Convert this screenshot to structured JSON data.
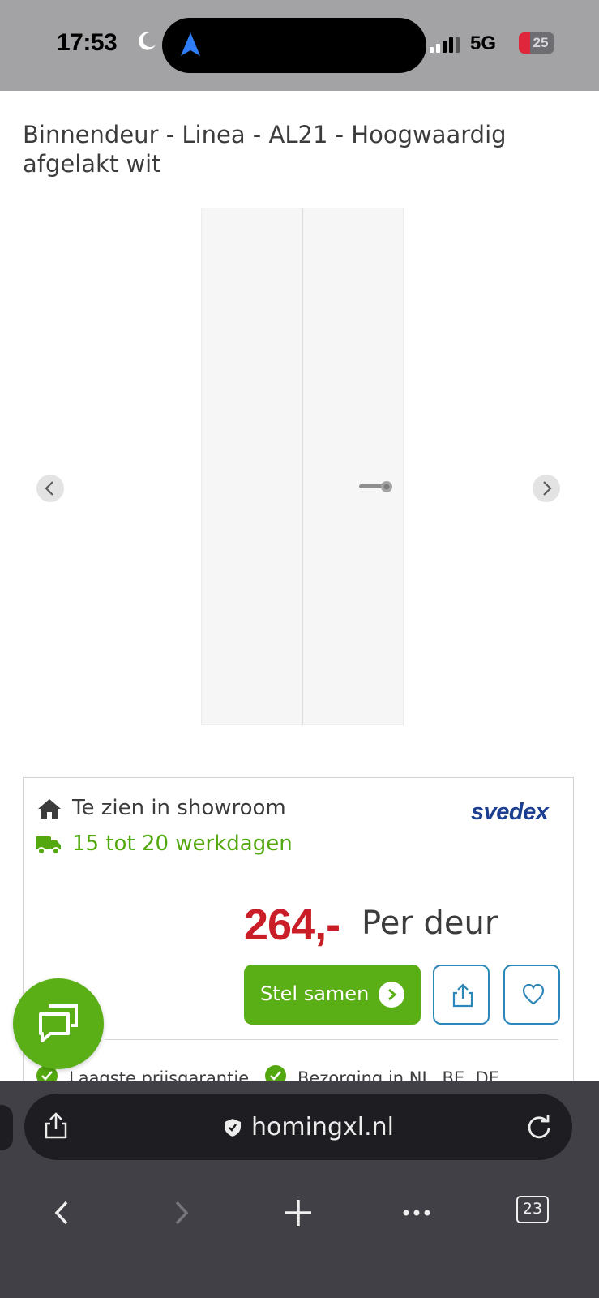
{
  "status_bar": {
    "time": "17:53",
    "network": "5G",
    "battery": "25"
  },
  "product": {
    "title": "Binnendeur - Linea - AL21 - Hoogwaardig afgelakt wit",
    "showroom": "Te zien in showroom",
    "delivery": "15 tot 20 werkdagen",
    "brand": "svedex",
    "price": "264,-",
    "price_unit": "Per deur",
    "cta_label": "Stel samen",
    "usps": [
      "Laagste prijsgarantie",
      "Bezorging in NL, BE, DE"
    ]
  },
  "browser": {
    "url": "homingxl.nl",
    "tab_count": "23"
  },
  "colors": {
    "accent_green": "#5aae16",
    "delivery_green": "#53a80f",
    "price_red": "#c91e27",
    "brand_blue": "#1c3f8f",
    "outline_blue": "#2d86b8",
    "browser_bar": "#404046"
  },
  "icons": {
    "status_moon": "moon-icon",
    "island_location": "location-arrow-icon",
    "gallery_prev": "chevron-left-icon",
    "gallery_next": "chevron-right-icon",
    "showroom": "home-icon",
    "delivery": "truck-icon",
    "cta": "chevron-right-circle-icon",
    "share": "share-icon",
    "wishlist": "heart-icon",
    "chat": "chat-icon",
    "secure": "shield-icon",
    "reload": "reload-icon",
    "back": "back-icon",
    "forward": "forward-icon",
    "new_tab": "plus-icon",
    "more": "more-icon"
  }
}
